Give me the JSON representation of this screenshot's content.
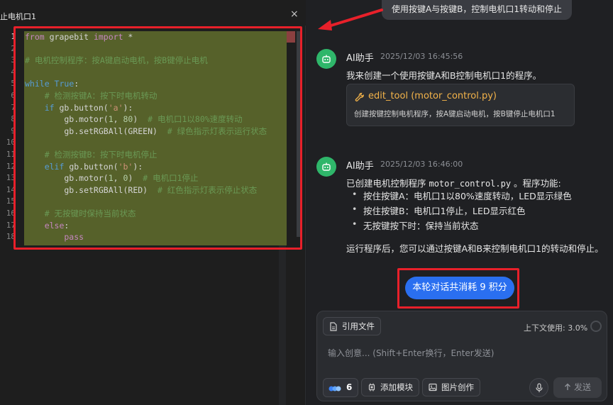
{
  "editor": {
    "tab_title": "止电机口1",
    "close_glyph": "×",
    "line_numbers": [
      "1",
      "2",
      "3",
      "4",
      "5",
      "6",
      "7",
      "8",
      "9",
      "10",
      "11",
      "12",
      "13",
      "14",
      "15",
      "16",
      "17",
      "18"
    ]
  },
  "code": {
    "l1_kw1": "from",
    "l1_mod": " grapebit ",
    "l1_kw2": "import",
    "l1_rest": " *",
    "l3_comment": "# 电机控制程序：按A键启动电机，按B键停止电机",
    "l5_kw": "while",
    "l5_true": " True",
    "l5_colon": ":",
    "l6_comment": "    # 检测按键A：按下时电机转动",
    "l7_kw": "    if",
    "l7_call": " gb.button(",
    "l7_str": "'a'",
    "l7_end": "):",
    "l8_call": "        gb.motor(",
    "l8_num1": "1",
    "l8_sep": ", ",
    "l8_num2": "80",
    "l8_close": ")  ",
    "l8_comment": "# 电机口1以80%速度转动",
    "l9_call": "        gb.setRGBAll(GREEN)  ",
    "l9_comment": "# 绿色指示灯表示运行状态",
    "l11_comment": "    # 检测按键B：按下时电机停止",
    "l12_kw": "    elif",
    "l12_call": " gb.button(",
    "l12_str": "'b'",
    "l12_end": "):",
    "l13_call": "        gb.motor(",
    "l13_num1": "1",
    "l13_sep": ", ",
    "l13_num2": "0",
    "l13_close": ")  ",
    "l13_comment": "# 电机口1停止",
    "l14_call": "        gb.setRGBAll(RED)  ",
    "l14_comment": "# 红色指示灯表示停止状态",
    "l16_comment": "    # 无按键时保持当前状态",
    "l17_kw": "    else",
    "l17_colon": ":",
    "l18_kw": "        pass"
  },
  "chat": {
    "top_prompt": "使用按键A与按键B，控制电机口1转动和停止",
    "msg1": {
      "name": "AI助手",
      "time": "2025/12/03 16:45:56",
      "text": "我来创建一个使用按键A和B控制电机口1的程序。",
      "tool_title": "edit_tool (motor_control.py)",
      "tool_desc": "创建按键控制电机程序，按A键启动电机，按B键停止电机口1"
    },
    "msg2": {
      "name": "AI助手",
      "time": "2025/12/03 16:46:00",
      "intro_pre": "已创建电机控制程序 ",
      "intro_code": "motor_control.py",
      "intro_post": " 。程序功能:",
      "bullets": [
        "按住按键A：电机口1以80%速度转动，LED显示绿色",
        "按住按键B：电机口1停止，LED显示红色",
        "无按键按下时：保持当前状态"
      ],
      "outro": "运行程序后，您可以通过按键A和B来控制电机口1的转动和停止。"
    },
    "cost_label": "本轮对话共消耗 9 积分"
  },
  "input": {
    "attach_label": "引用文件",
    "context_label": "上下文使用: 3.0%",
    "placeholder": "输入创意... (Shift+Enter换行，Enter发送)",
    "model_count": "6",
    "add_module_label": "添加模块",
    "image_create_label": "图片创作",
    "send_label": "发送"
  },
  "colors": {
    "accent": "#2a6ff0",
    "annotation_red": "#e8202a",
    "avatar_green": "#2fb66a",
    "code_highlight": "#56612a",
    "tool_title": "#f3b34a"
  },
  "icons": {
    "avatar": "robot-icon",
    "tool": "wrench-icon",
    "attach": "document-icon",
    "model": "model-dots-icon",
    "module": "chip-icon",
    "image": "image-icon",
    "mic": "microphone-icon",
    "send": "arrow-up-icon",
    "arrow": "red-arrow-annotation"
  }
}
